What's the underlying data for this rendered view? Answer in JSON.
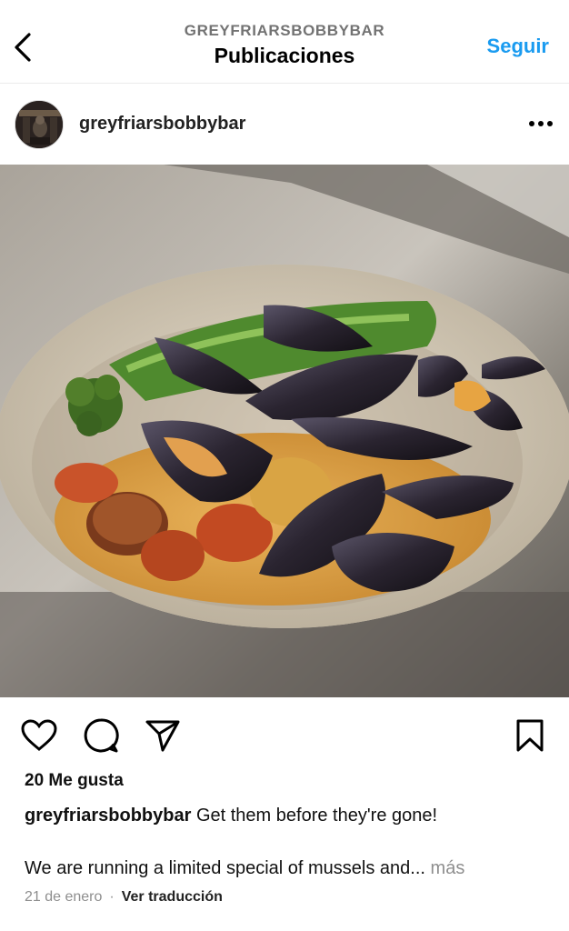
{
  "header": {
    "account": "GREYFRIARSBOBBYBAR",
    "title": "Publicaciones",
    "follow": "Seguir",
    "back_icon": "chevron-left-icon"
  },
  "post": {
    "username": "greyfriarsbobbybar",
    "likes": "20 Me gusta",
    "caption_text": "Get them before they're gone!",
    "caption_more_text": "We are running a limited special of mussels and...",
    "more_label": "más",
    "date": "21 de enero",
    "separator": "·",
    "translate": "Ver traducción"
  },
  "icons": [
    "heart-icon",
    "comment-icon",
    "share-icon",
    "bookmark-icon",
    "more-dots-icon"
  ],
  "colors": {
    "follow": "#1a9bf0",
    "muted": "#8e8e8e"
  }
}
